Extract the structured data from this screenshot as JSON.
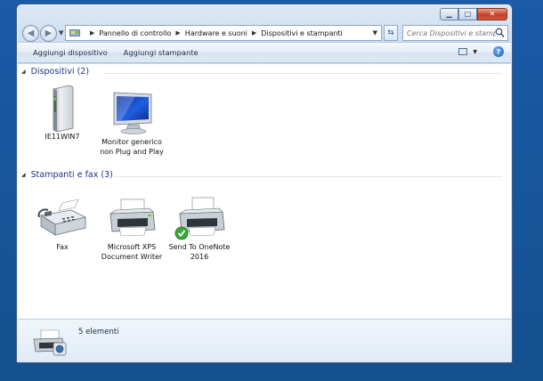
{
  "window": {
    "caption": {
      "minimize_icon": "minimize-icon",
      "maximize_icon": "maximize-icon",
      "close_icon": "close-icon"
    }
  },
  "address_bar": {
    "segments": [
      "Pannello di controllo",
      "Hardware e suoni",
      "Dispositivi e stampanti"
    ]
  },
  "search": {
    "placeholder": "Cerca Dispositivi e stampanti"
  },
  "toolbar": {
    "add_device": "Aggiungi dispositivo",
    "add_printer": "Aggiungi stampante"
  },
  "groups": {
    "devices": {
      "title": "Dispositivi (2)",
      "items": [
        {
          "label": "IE11WIN7",
          "icon": "computer-tower-icon"
        },
        {
          "label": "Monitor generico non Plug and Play",
          "icon": "monitor-icon"
        }
      ]
    },
    "printers": {
      "title": "Stampanti e fax (3)",
      "items": [
        {
          "label": "Fax",
          "icon": "fax-icon"
        },
        {
          "label": "Microsoft XPS Document Writer",
          "icon": "printer-icon"
        },
        {
          "label": "Send To OneNote 2016",
          "icon": "printer-default-icon"
        }
      ]
    }
  },
  "details": {
    "count_text": "5 elementi"
  },
  "colors": {
    "desktop": "#17539c",
    "group_header": "#1e3287",
    "close_button": "#c4412a"
  }
}
